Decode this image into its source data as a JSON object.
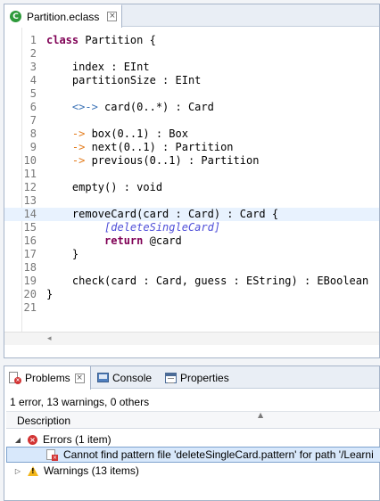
{
  "editor": {
    "tab_title": "Partition.eclass",
    "tab_icon": "ecore-class-icon",
    "current_line": 14,
    "lines": [
      [
        {
          "t": "class",
          "c": "kw"
        },
        {
          "t": " Partition {"
        }
      ],
      [],
      [
        {
          "t": "    index : EInt"
        }
      ],
      [
        {
          "t": "    partitionSize : EInt"
        }
      ],
      [],
      [
        {
          "t": "    "
        },
        {
          "t": "<>->",
          "c": "assoc"
        },
        {
          "t": " card(0..*) : Card"
        }
      ],
      [],
      [
        {
          "t": "    "
        },
        {
          "t": "->",
          "c": "arrow"
        },
        {
          "t": " box(0..1) : Box"
        }
      ],
      [
        {
          "t": "    "
        },
        {
          "t": "->",
          "c": "arrow"
        },
        {
          "t": " next(0..1) : Partition"
        }
      ],
      [
        {
          "t": "    "
        },
        {
          "t": "->",
          "c": "arrow"
        },
        {
          "t": " previous(0..1) : Partition"
        }
      ],
      [],
      [
        {
          "t": "    empty() : void"
        }
      ],
      [],
      [
        {
          "t": "    removeCard(card : Card) : Card {"
        }
      ],
      [
        {
          "t": "         "
        },
        {
          "t": "[deleteSingleCard]",
          "c": "ann"
        }
      ],
      [
        {
          "t": "         "
        },
        {
          "t": "return",
          "c": "kw"
        },
        {
          "t": " @card"
        }
      ],
      [
        {
          "t": "    }"
        }
      ],
      [],
      [
        {
          "t": "    check(card : Card, guess : EString) : EBoolean"
        }
      ],
      [
        {
          "t": "}"
        }
      ],
      []
    ]
  },
  "bottom_view": {
    "tabs": [
      {
        "label": "Problems",
        "icon": "problems-icon",
        "active": true
      },
      {
        "label": "Console",
        "icon": "console-icon"
      },
      {
        "label": "Properties",
        "icon": "properties-icon"
      }
    ],
    "summary": "1 error, 13 warnings, 0 others",
    "column_header": "Description",
    "errors_group": "Errors (1 item)",
    "error_item": "Cannot find pattern file 'deleteSingleCard.pattern' for path '/Learni",
    "warnings_group": "Warnings (13 items)"
  }
}
